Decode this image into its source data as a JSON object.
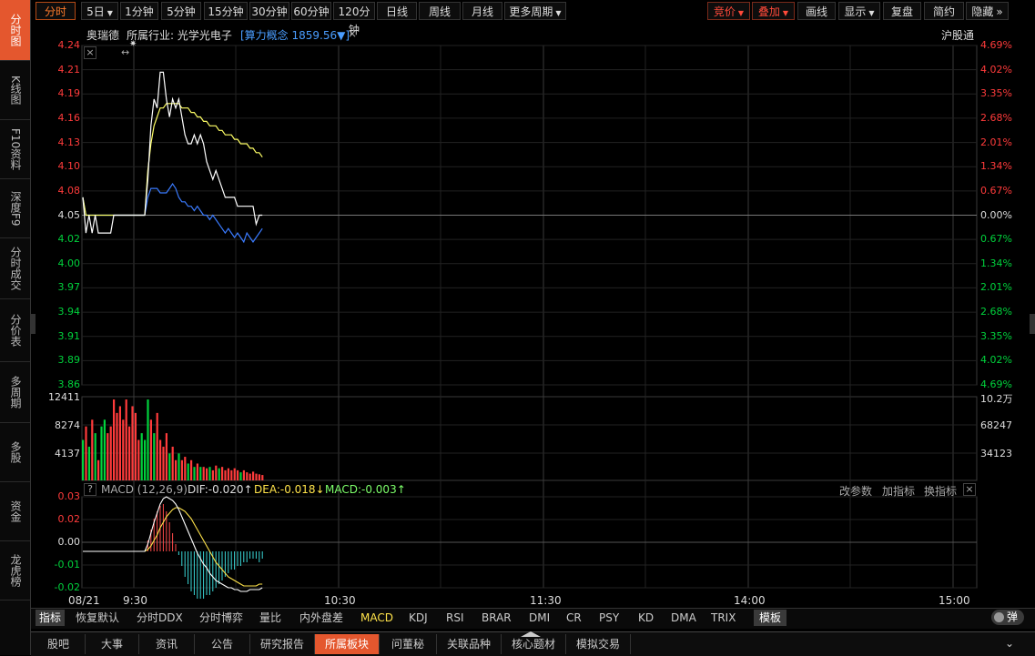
{
  "left_nav": [
    "分时图",
    "K线图",
    "F10资料",
    "深度F9",
    "分时成交",
    "分价表",
    "多周期",
    "多股",
    "资金",
    "龙虎榜"
  ],
  "toolbar": {
    "items": [
      "分时",
      "5日",
      "1分钟",
      "5分钟",
      "15分钟",
      "30分钟",
      "60分钟",
      "120分钟",
      "日线",
      "周线",
      "月线",
      "更多周期"
    ],
    "right_items": [
      "竞价",
      "叠加",
      "画线",
      "显示",
      "复盘",
      "简约",
      "隐藏"
    ]
  },
  "info_bar": {
    "stock_name": "奥瑞德",
    "industry": "所属行业: 光学光电子",
    "concept": "[算力概念 1859.56▼]",
    "close_label": "×",
    "exchange": "沪股通"
  },
  "price_axis": {
    "left": [
      "4.24",
      "4.21",
      "4.19",
      "4.16",
      "4.13",
      "4.10",
      "4.08",
      "4.05",
      "4.02",
      "4.00",
      "3.97",
      "3.94",
      "3.91",
      "3.89",
      "3.86"
    ],
    "right": [
      "4.69%",
      "4.02%",
      "3.35%",
      "2.68%",
      "2.01%",
      "1.34%",
      "0.67%",
      "0.00%",
      "0.67%",
      "1.34%",
      "2.01%",
      "2.68%",
      "3.35%",
      "4.02%",
      "4.69%"
    ],
    "ref_price": 4.05,
    "min": 3.86,
    "max": 4.24
  },
  "price_series": {
    "price": [
      4.07,
      4.03,
      4.05,
      4.03,
      4.05,
      4.03,
      4.03,
      4.03,
      4.03,
      4.03,
      4.05,
      4.05,
      4.05,
      4.05,
      4.05,
      4.05,
      4.05,
      4.05,
      4.05,
      4.05,
      4.05,
      4.09,
      4.15,
      4.18,
      4.17,
      4.21,
      4.21,
      4.18,
      4.16,
      4.18,
      4.17,
      4.18,
      4.16,
      4.14,
      4.13,
      4.13,
      4.14,
      4.13,
      4.14,
      4.13,
      4.11,
      4.1,
      4.09,
      4.1,
      4.09,
      4.08,
      4.07,
      4.07,
      4.07,
      4.07,
      4.06,
      4.06,
      4.06,
      4.06,
      4.06,
      4.06,
      4.04,
      4.05,
      4.05
    ],
    "avg": [
      4.07,
      4.05,
      4.05,
      4.05,
      4.05,
      4.05,
      4.05,
      4.05,
      4.05,
      4.05,
      4.05,
      4.05,
      4.05,
      4.05,
      4.05,
      4.05,
      4.05,
      4.05,
      4.05,
      4.05,
      4.05,
      4.1,
      4.13,
      4.15,
      4.16,
      4.17,
      4.17,
      4.175,
      4.175,
      4.175,
      4.175,
      4.175,
      4.17,
      4.17,
      4.17,
      4.165,
      4.165,
      4.16,
      4.16,
      4.155,
      4.155,
      4.15,
      4.15,
      4.15,
      4.145,
      4.145,
      4.14,
      4.14,
      4.14,
      4.135,
      4.135,
      4.13,
      4.13,
      4.13,
      4.125,
      4.125,
      4.12,
      4.12,
      4.115
    ],
    "overlay": [
      4.07,
      4.05,
      4.05,
      4.05,
      4.05,
      4.05,
      4.05,
      4.05,
      4.05,
      4.05,
      4.05,
      4.05,
      4.05,
      4.05,
      4.05,
      4.05,
      4.05,
      4.05,
      4.05,
      4.05,
      4.05,
      4.07,
      4.08,
      4.08,
      4.08,
      4.075,
      4.075,
      4.075,
      4.08,
      4.085,
      4.08,
      4.07,
      4.065,
      4.065,
      4.06,
      4.06,
      4.055,
      4.06,
      4.055,
      4.05,
      4.05,
      4.045,
      4.05,
      4.045,
      4.04,
      4.035,
      4.03,
      4.035,
      4.03,
      4.025,
      4.03,
      4.025,
      4.02,
      4.03,
      4.025,
      4.02,
      4.025,
      4.03,
      4.035
    ]
  },
  "volume_axis": {
    "left": [
      "12411",
      "8274",
      "4137"
    ],
    "right": [
      "10.2万",
      "68247",
      "34123"
    ],
    "max": 102000
  },
  "volume_series": [
    6000,
    8000,
    5000,
    9000,
    7000,
    3000,
    8000,
    9000,
    7000,
    8000,
    12000,
    10000,
    11000,
    9000,
    12000,
    8000,
    11000,
    10000,
    6000,
    7000,
    6000,
    12000,
    9000,
    7000,
    10000,
    6000,
    5000,
    7000,
    4000,
    5000,
    3000,
    4000,
    3000,
    3500,
    2500,
    3000,
    2000,
    2500,
    2000,
    2000,
    1800,
    2000,
    1500,
    2200,
    1800,
    2000,
    1500,
    1800,
    1500,
    1800,
    1500,
    1200,
    1500,
    1200,
    1000,
    1300,
    1000,
    900,
    800
  ],
  "volume_colors": [
    "green",
    "red",
    "green",
    "red",
    "green",
    "red",
    "green",
    "green",
    "red",
    "red",
    "red",
    "red",
    "red",
    "red",
    "red",
    "red",
    "red",
    "red",
    "red",
    "green",
    "green",
    "green",
    "red",
    "green",
    "red",
    "red",
    "red",
    "red",
    "green",
    "red",
    "red",
    "green",
    "red",
    "red",
    "green",
    "red",
    "green",
    "red",
    "green",
    "red",
    "red",
    "green",
    "red",
    "red",
    "green",
    "red",
    "red",
    "red",
    "red",
    "red",
    "red",
    "green",
    "red",
    "red",
    "red",
    "red",
    "red",
    "red",
    "red"
  ],
  "macd_header": {
    "help": "?",
    "name": "MACD (12,26,9)",
    "dif": "DIF:-0.020↑",
    "dea": "DEA:-0.018↓",
    "macd": "MACD:-0.003↑",
    "change_params": "改参数",
    "add_indicator": "加指标",
    "swap_indicator": "换指标",
    "close": "×"
  },
  "macd_axis": {
    "left": [
      "0.03",
      "0.02",
      "0.00",
      "-0.01",
      "-0.02"
    ]
  },
  "macd_series": {
    "dif": [
      0,
      0,
      0,
      0,
      0,
      0,
      0,
      0,
      0,
      0,
      0,
      0,
      0,
      0,
      0,
      0,
      0,
      0,
      0,
      0,
      0,
      0.004,
      0.01,
      0.016,
      0.021,
      0.026,
      0.029,
      0.03,
      0.029,
      0.028,
      0.026,
      0.023,
      0.019,
      0.015,
      0.011,
      0.007,
      0.003,
      -0.001,
      -0.004,
      -0.007,
      -0.009,
      -0.012,
      -0.014,
      -0.016,
      -0.017,
      -0.018,
      -0.019,
      -0.02,
      -0.02,
      -0.021,
      -0.021,
      -0.022,
      -0.022,
      -0.022,
      -0.021,
      -0.021,
      -0.021,
      -0.021,
      -0.02
    ],
    "dea": [
      0,
      0,
      0,
      0,
      0,
      0,
      0,
      0,
      0,
      0,
      0,
      0,
      0,
      0,
      0,
      0,
      0,
      0,
      0,
      0,
      0,
      0.001,
      0.003,
      0.006,
      0.009,
      0.013,
      0.016,
      0.019,
      0.021,
      0.023,
      0.024,
      0.024,
      0.023,
      0.022,
      0.02,
      0.018,
      0.015,
      0.012,
      0.009,
      0.006,
      0.003,
      0.0,
      -0.003,
      -0.006,
      -0.008,
      -0.01,
      -0.012,
      -0.014,
      -0.015,
      -0.016,
      -0.017,
      -0.018,
      -0.019,
      -0.019,
      -0.019,
      -0.019,
      -0.019,
      -0.018,
      -0.018
    ],
    "hist": [
      0,
      0,
      0,
      0,
      0,
      0,
      0,
      0,
      0,
      0,
      0,
      0,
      0,
      0,
      0,
      0,
      0,
      0,
      0,
      0,
      0,
      0.006,
      0.012,
      0.018,
      0.022,
      0.025,
      0.026,
      0.022,
      0.016,
      0.01,
      0.004,
      -0.002,
      -0.008,
      -0.014,
      -0.018,
      -0.022,
      -0.024,
      -0.026,
      -0.026,
      -0.026,
      -0.024,
      -0.024,
      -0.022,
      -0.02,
      -0.018,
      -0.016,
      -0.014,
      -0.012,
      -0.01,
      -0.01,
      -0.008,
      -0.008,
      -0.006,
      -0.006,
      -0.004,
      -0.004,
      -0.004,
      -0.006,
      -0.004
    ]
  },
  "time_axis": [
    "08/21",
    "9:30",
    "10:30",
    "11:30",
    "14:00",
    "15:00"
  ],
  "indicator_bar": {
    "label": "指标",
    "items": [
      "恢复默认",
      "分时DDX",
      "分时博弈",
      "量比",
      "内外盘差",
      "MACD",
      "KDJ",
      "RSI",
      "BRAR",
      "DMI",
      "CR",
      "PSY",
      "KD",
      "DMA",
      "TRIX"
    ],
    "template": "模板",
    "popup": "弹"
  },
  "bottom_tabs": [
    "股吧",
    "大事",
    "资讯",
    "公告",
    "研究报告",
    "所属板块",
    "问董秘",
    "关联品种",
    "核心题材",
    "模拟交易"
  ],
  "colors": {
    "up": "#ff3b3b",
    "down": "#00d23c",
    "price_line": "#ffffff",
    "avg_line": "#ffff66",
    "overlay_line": "#3a7bff",
    "accent": "#e4572e"
  }
}
